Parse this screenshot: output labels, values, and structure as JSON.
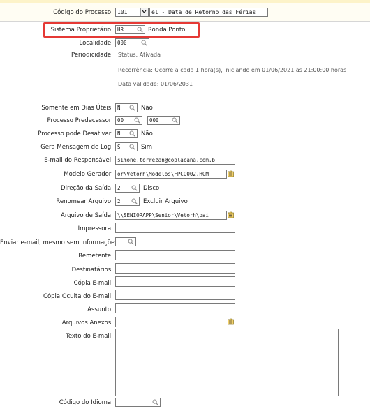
{
  "header": {
    "codigo_label": "Código do Processo:",
    "codigo_value": "101",
    "codigo_desc": "el - Data de Retorno das Férias"
  },
  "fields": {
    "sistema_label": "Sistema Proprietário:",
    "sistema_value": "HR",
    "sistema_desc": "Ronda Ponto",
    "localidade_label": "Localidade:",
    "localidade_value": "000",
    "periodicidade_label": "Periodicidade:",
    "periodicidade_status": "Status: Ativada",
    "periodicidade_recorrencia": "Recorrência: Ocorre a cada 1 hora(s), iniciando em 01/06/2021 às 21:00:00 horas",
    "periodicidade_validade": "Data validade: 01/06/2031",
    "dias_uteis_label": "Somente em Dias Úteis:",
    "dias_uteis_value": "N",
    "dias_uteis_desc": "Não",
    "predecessor_label": "Processo Predecessor:",
    "predecessor_value1": "00",
    "predecessor_value2": "000",
    "desativar_label": "Processo pode Desativar:",
    "desativar_value": "N",
    "desativar_desc": "Não",
    "log_label": "Gera Mensagem de Log:",
    "log_value": "S",
    "log_desc": "Sim",
    "email_resp_label": "E-mail do Responsável:",
    "email_resp_value": "simone.torrezan@coplacana.com.b",
    "modelo_label": "Modelo Gerador:",
    "modelo_value": "or\\Vetorh\\Modelos\\FPCO002.HCM",
    "direcao_label": "Direção da Saída:",
    "direcao_value": "2",
    "direcao_desc": "Disco",
    "renomear_label": "Renomear Arquivo:",
    "renomear_value": "2",
    "renomear_desc": "Excluir Arquivo",
    "arquivo_saida_label": "Arquivo de Saída:",
    "arquivo_saida_value": "\\\\SENIORAPP\\Senior\\Vetorh\\pai",
    "impressora_label": "Impressora:",
    "enviar_label": "Enviar e-mail, mesmo sem Informações:",
    "remetente_label": "Remetente:",
    "destinatarios_label": "Destinatários:",
    "copia_label": "Cópia E-mail:",
    "copia_oculta_label": "Cópia Oculta do E-mail:",
    "assunto_label": "Assunto:",
    "anexos_label": "Arquivos Anexos:",
    "texto_label": "Texto do E-mail:",
    "idioma_label": "Código do Idioma:"
  },
  "colors": {
    "highlight": "#e53935",
    "topstrip": "#fdf3c9"
  },
  "icons": {
    "lookup": "magnifier-icon",
    "folder": "folder-open-icon",
    "dropdown": "chevron-down-icon"
  }
}
